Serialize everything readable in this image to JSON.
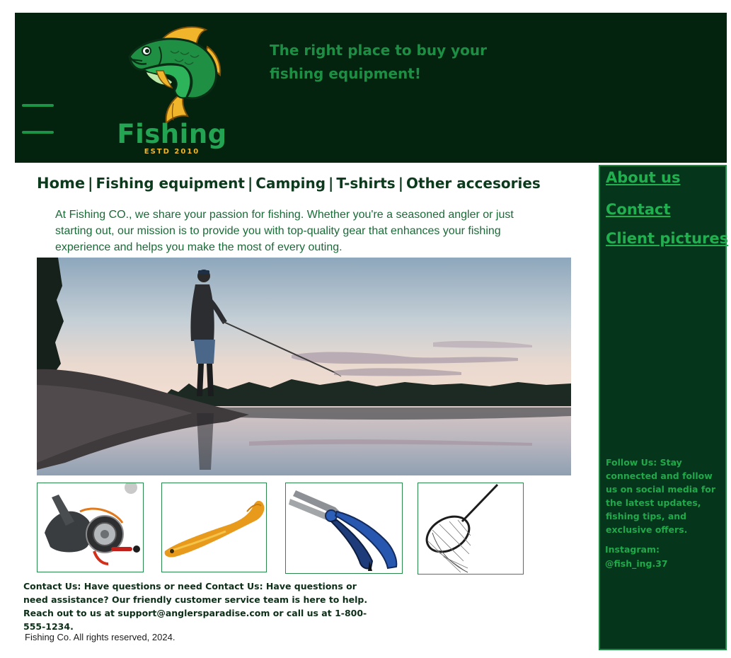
{
  "header": {
    "brand_name": "Fishing",
    "brand_estd": "ESTD 2010",
    "tagline": "The right place to buy your fishing equipment!",
    "logo_icon": "jumping-fish-icon",
    "menu_icon": "hamburger-menu-icon"
  },
  "nav": {
    "home": "Home",
    "separator": "|",
    "fishing_equipment": "Fishing equipment",
    "camping": "Camping",
    "tshirts": "T-shirts",
    "other": "Other accesories"
  },
  "intro": "At Fishing CO., we share your passion for fishing. Whether you're a seasoned angler or just starting out, our mission is to provide you with top-quality gear that enhances your fishing experience and helps you make the most of every outing.",
  "products": [
    "fishing-reel",
    "soft-lure",
    "fishing-pliers",
    "landing-net"
  ],
  "contact": "Contact Us: Have questions or need Contact Us: Have questions or need assistance? Our friendly customer service team is here to help. Reach out to us at support@anglersparadise.com or call us at 1-800-555-1234.",
  "copyright": "Fishing Co. All rights reserved, 2024.",
  "sidebar": {
    "about": "About us",
    "contact": "Contact",
    "client_pictures": "Client pictures",
    "follow": "Follow Us: Stay connected and follow us on social media for the latest updates, fishing tips, and exclusive offers.",
    "instagram": "Instagram: @fish_ing.37"
  },
  "colors": {
    "header_bg": "#04230f",
    "sidebar_bg": "#05361b",
    "accent_green": "#21b04f",
    "logo_gold": "#f0b52a"
  }
}
